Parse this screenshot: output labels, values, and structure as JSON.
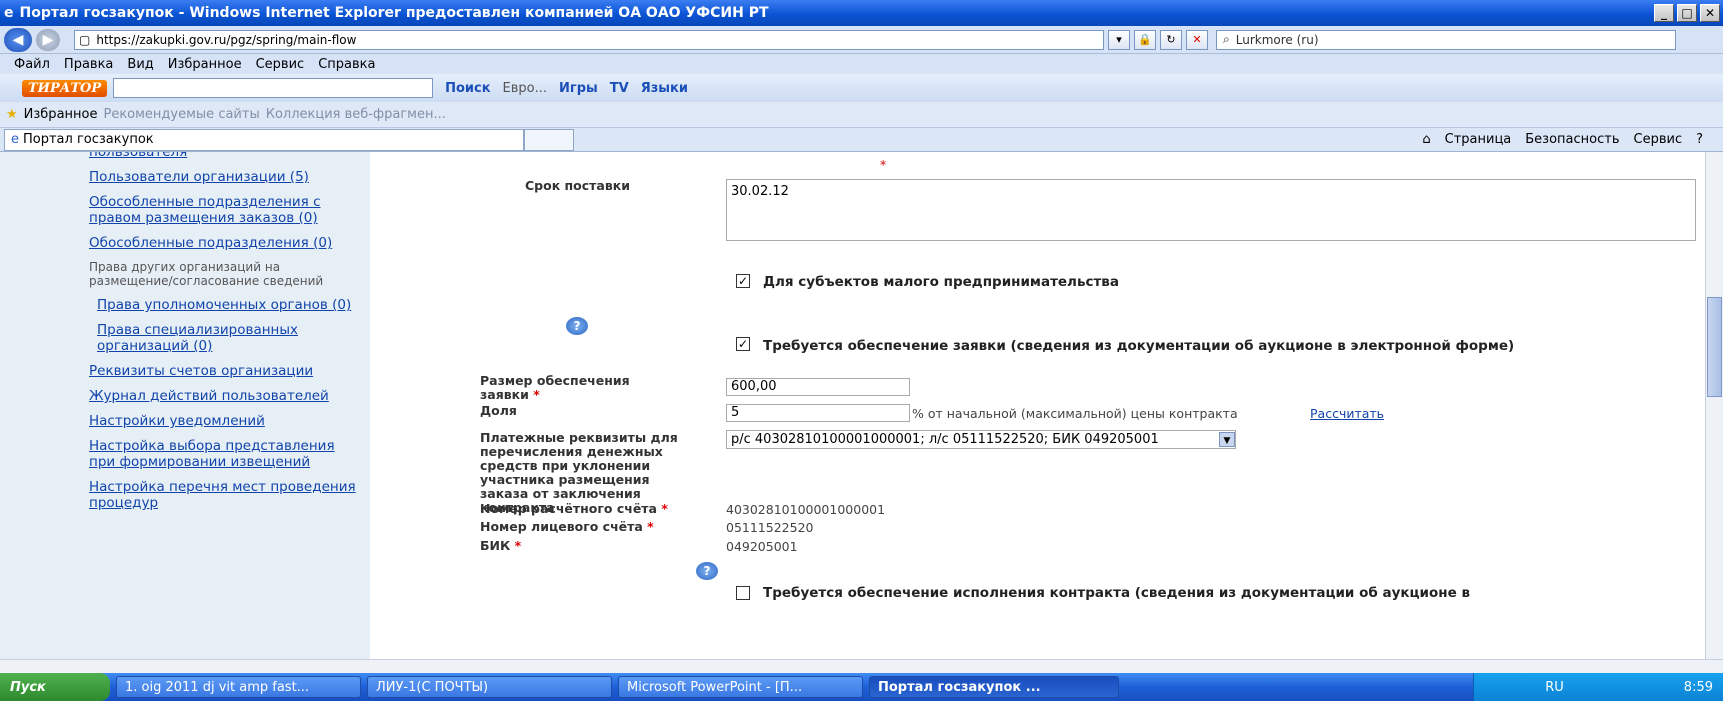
{
  "window": {
    "title": "Портал госзакупок - Windows Internet Explorer предоставлен компанией ОА ОАО УФСИН РТ"
  },
  "address": {
    "url": "https://zakupki.gov.ru/pgz/spring/main-flow",
    "search": "Lurkmore (ru)"
  },
  "menu": [
    "Файл",
    "Правка",
    "Вид",
    "Избранное",
    "Сервис",
    "Справка"
  ],
  "toolbar": {
    "logo": "ТИРАТОР",
    "search": "Поиск",
    "euro": "Евро...",
    "games": "Игры",
    "tv": "TV",
    "langs": "Языки"
  },
  "favorites": {
    "label": "Избранное",
    "rec": "Рекомендуемые сайты",
    "coll": "Коллекция веб-фрагмен..."
  },
  "tab": {
    "title": "Портал госзакупок"
  },
  "commands": [
    "Страница",
    "Безопасность",
    "Сервис"
  ],
  "sidebar": {
    "links": [
      {
        "t": "пользователя",
        "type": "link"
      },
      {
        "t": "Пользователи организации (5)",
        "type": "link"
      },
      {
        "t": "Обособленные подразделения с правом размещения заказов (0)",
        "type": "link"
      },
      {
        "t": "Обособленные подразделения (0)",
        "type": "link"
      },
      {
        "t": "Права других организаций на размещение/согласование сведений",
        "type": "text"
      },
      {
        "t": "Права уполномоченных органов (0)",
        "type": "link",
        "indent": true
      },
      {
        "t": "Права специализированных организаций (0)",
        "type": "link",
        "indent": true
      },
      {
        "t": "Реквизиты счетов организации",
        "type": "link"
      },
      {
        "t": "Журнал действий пользователей",
        "type": "link"
      },
      {
        "t": "Настройки уведомлений",
        "type": "link"
      },
      {
        "t": "Настройка выбора представления при формировании извещений",
        "type": "link"
      },
      {
        "t": "Настройка перечня мест проведения процедур",
        "type": "link"
      }
    ]
  },
  "form": {
    "delivery_label": "Срок поставки",
    "delivery_value": "30.02.12",
    "small_business": "Для субъектов малого предпринимательства",
    "bid_security": "Требуется обеспечение заявки (сведения из документации об аукционе в электронной форме)",
    "amount_label": "Размер обеспечения заявки",
    "amount_value": "600,00",
    "share_label": "Доля",
    "share_value": "5",
    "share_suffix": "% от начальной (максимальной) цены контракта",
    "calc": "Рассчитать",
    "payment_label": "Платежные реквизиты для перечисления денежных средств при уклонении участника размещения заказа от заключения контракта",
    "payment_value": "р/с 40302810100001000001; л/с 05111522520; БИК 049205001",
    "account_label": "Номер расчётного счёта",
    "account_value": "40302810100001000001",
    "personal_label": "Номер лицевого счёта",
    "personal_value": "05111522520",
    "bik_label": "БИК",
    "bik_value": "049205001",
    "contract_security": "Требуется обеспечение исполнения контракта (сведения из документации об аукционе в"
  },
  "taskbar": {
    "start": "Пуск",
    "tasks": [
      "1. oig 2011 dj vit amp fast...",
      "ЛИУ-1(С ПОЧТЫ)",
      "Microsoft PowerPoint - [П...",
      "Портал госзакупок ..."
    ],
    "lang": "RU",
    "clock": "8:59"
  }
}
